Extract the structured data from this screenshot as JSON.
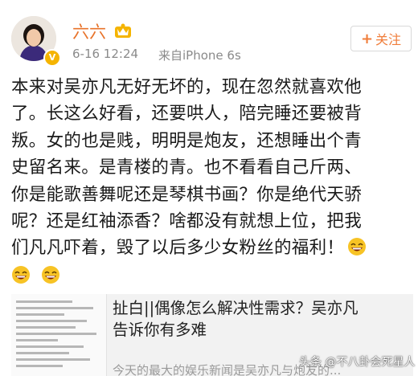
{
  "post": {
    "author": "六六",
    "time": "6-16 12:24",
    "source": "来自iPhone 6s",
    "follow_label": "关注",
    "body_lines": [
      "本来对吴亦凡无好无坏的，现在忽然就喜欢他",
      "了。长这么好看，还要哄人，陪完睡还要被背",
      "叛。女的也是贱，明明是炮友，还想睡出个青",
      "史留名来。是青楼的青。也不看看自己斤两、",
      "你是能歌善舞呢还是琴棋书画？你是绝代天骄",
      "呢？还是红袖添香？啥都没有就想上位，把我",
      "们凡凡吓着，毁了以后多少女粉丝的福利！"
    ]
  },
  "share_card": {
    "title_line1": "扯白||偶像怎么解决性需求？吴亦凡",
    "title_line2": "告诉你有多难",
    "snippet": "今天的最大的娱乐新闻是吴亦凡与炮友的..."
  },
  "watermark": "头条 @不八卦会死星人",
  "colors": {
    "username": "#e8732a",
    "follow_accent": "#f07d3a",
    "meta": "#8a8a8a",
    "emoji_face": "#f7c325"
  },
  "icons": [
    "avatar",
    "verified-badge-icon",
    "vip-crown-icon",
    "plus-icon",
    "grin-emoji-icon"
  ]
}
